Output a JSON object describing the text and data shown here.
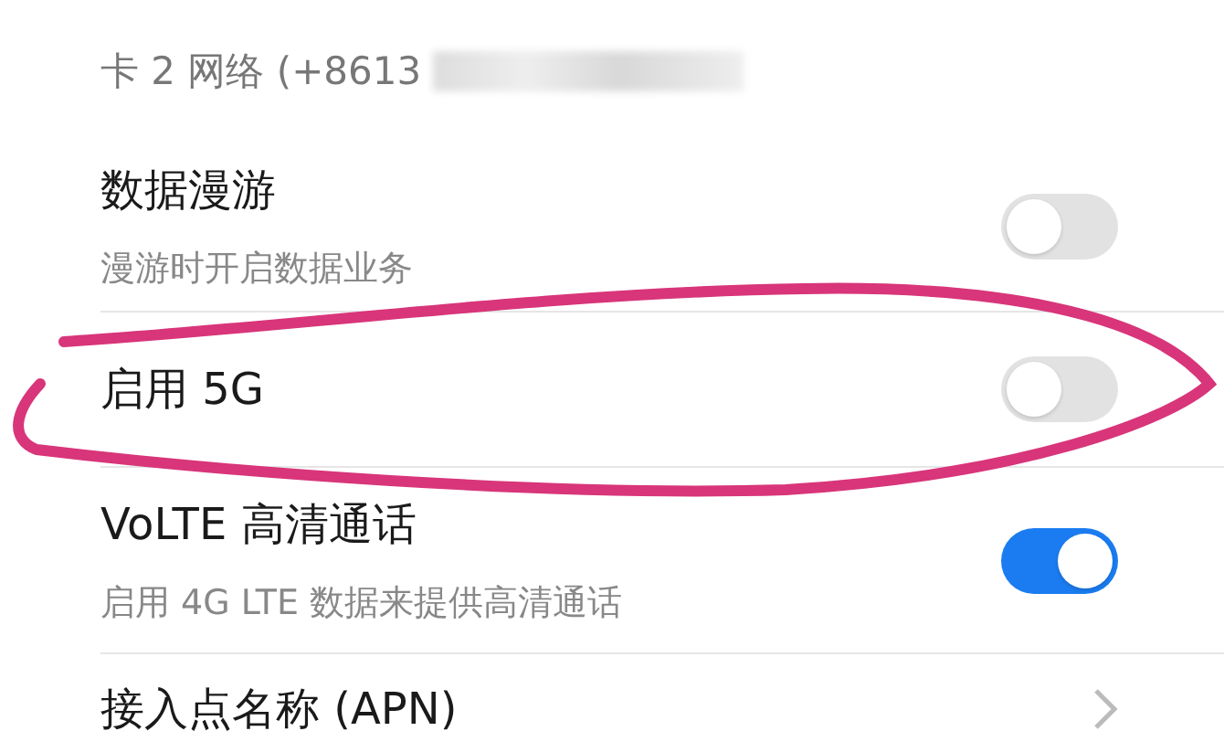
{
  "section_header": "卡 2 网络 (+8613",
  "settings": [
    {
      "kind": "toggle",
      "title": "数据漫游",
      "subtitle": "漫游时开启数据业务",
      "on": false
    },
    {
      "kind": "toggle",
      "title": "启用 5G",
      "on": false
    },
    {
      "kind": "toggle",
      "title": "VoLTE 高清通话",
      "subtitle": "启用 4G LTE 数据来提供高清通话",
      "on": true
    },
    {
      "kind": "link",
      "title": "接入点名称 (APN)"
    }
  ]
}
